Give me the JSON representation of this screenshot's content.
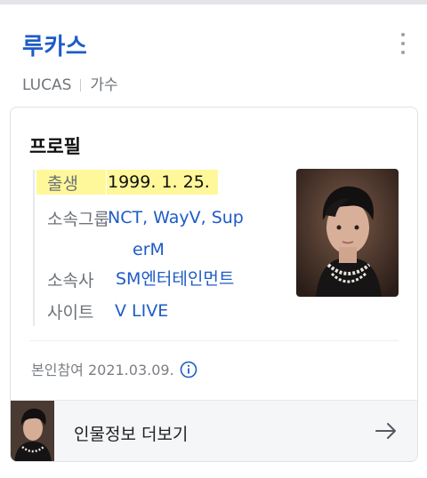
{
  "header": {
    "title": "루카스",
    "latin_name": "LUCAS",
    "occupation": "가수"
  },
  "profile": {
    "heading": "프로필",
    "rows": [
      {
        "label": "출생",
        "value": "1999. 1. 25."
      },
      {
        "label": "소속그룹",
        "value_line1": "NCT, WayV, Sup",
        "value_line2": "erM"
      },
      {
        "label": "소속사",
        "value": "SM엔터테인먼트"
      },
      {
        "label": "사이트",
        "value": "V LIVE"
      }
    ],
    "self_reference": "본인참여 2021.03.09."
  },
  "footer": {
    "more_label": "인물정보 더보기"
  },
  "icons": [
    "more-vertical-icon",
    "info-icon",
    "arrow-right-icon"
  ],
  "colors": {
    "accent": "#1e5bc6",
    "highlight": "#fff89a"
  }
}
